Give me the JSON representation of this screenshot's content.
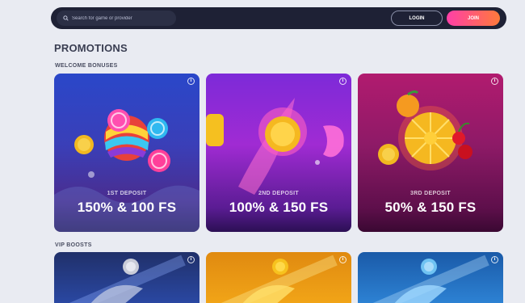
{
  "header": {
    "search_placeholder": "Search for game or provider",
    "login_label": "LOGIN",
    "join_label": "JOIN"
  },
  "page": {
    "title": "PROMOTIONS"
  },
  "sections": {
    "welcome": {
      "title": "WELCOME BONUSES",
      "cards": [
        {
          "sub": "1ST DEPOSIT",
          "main": "150% & 100 FS"
        },
        {
          "sub": "2ND DEPOSIT",
          "main": "100% & 150 FS"
        },
        {
          "sub": "3RD DEPOSIT",
          "main": "50% & 150 FS"
        }
      ]
    },
    "vip": {
      "title": "VIP BOOSTS"
    }
  },
  "icons": {
    "search": "search-icon",
    "info": "info-icon"
  },
  "colors": {
    "nav_bg": "#1e2135",
    "join_gradient_start": "#ff3fa8",
    "join_gradient_end": "#ff7a3a",
    "page_bg": "#e9ebf2"
  }
}
